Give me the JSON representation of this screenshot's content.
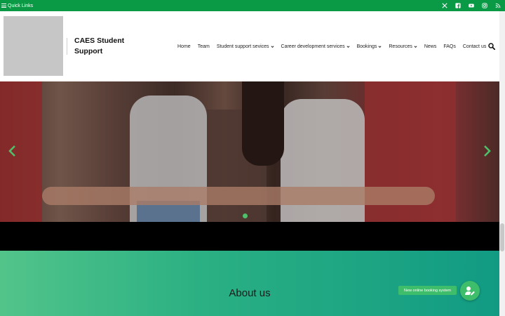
{
  "topbar": {
    "quick_links_label": "Quick Links",
    "bg_color": "#0a9a46",
    "socials": [
      "x-icon",
      "facebook-icon",
      "youtube-icon",
      "instagram-icon",
      "rss-icon"
    ]
  },
  "header": {
    "site_title_line1": "CAES Student",
    "site_title_line2": "Support"
  },
  "nav": {
    "items": [
      {
        "label": "Home",
        "has_dropdown": false
      },
      {
        "label": "Team",
        "has_dropdown": false
      },
      {
        "label": "Student support sevices",
        "has_dropdown": true
      },
      {
        "label": "Career development services",
        "has_dropdown": true
      },
      {
        "label": "Bookings",
        "has_dropdown": true
      },
      {
        "label": "Resources",
        "has_dropdown": true
      },
      {
        "label": "News",
        "has_dropdown": false
      },
      {
        "label": "FAQs",
        "has_dropdown": false
      },
      {
        "label": "Contact us",
        "has_dropdown": false
      }
    ]
  },
  "hero": {
    "active_slide_color": "#4fc06a"
  },
  "about": {
    "title": "About us"
  },
  "booking": {
    "label": "New online booking system",
    "accent": "#3ebd6b"
  }
}
